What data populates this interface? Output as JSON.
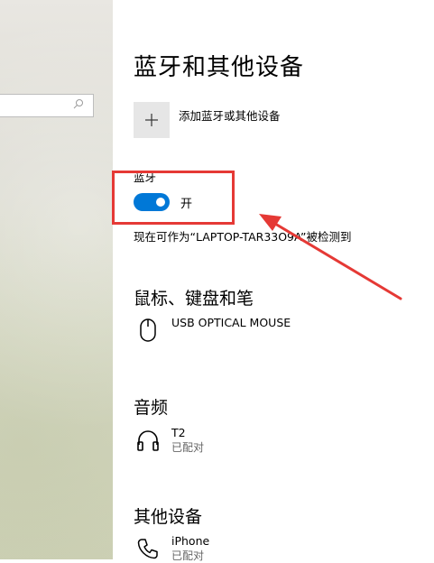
{
  "page_title": "蓝牙和其他设备",
  "add_device_label": "添加蓝牙或其他设备",
  "bluetooth": {
    "label": "蓝牙",
    "state": "开",
    "discoverable_text": "现在可作为“LAPTOP-TAR33O9A”被检测到"
  },
  "sections": {
    "mouse": {
      "title": "鼠标、键盘和笔",
      "device_name": "USB OPTICAL MOUSE",
      "icon": "mouse-icon"
    },
    "audio": {
      "title": "音频",
      "device_name": "T2",
      "device_status": "已配对",
      "icon": "headphones-icon"
    },
    "other": {
      "title": "其他设备",
      "device_name": "iPhone",
      "device_status": "已配对",
      "icon": "phone-icon"
    }
  },
  "colors": {
    "accent": "#0078d7",
    "annotation": "#e53935"
  }
}
